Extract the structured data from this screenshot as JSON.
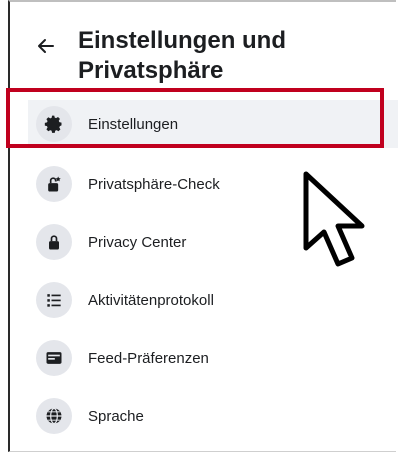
{
  "header": {
    "back_icon": "arrow-left-icon",
    "title": "Einstellungen und Privatsphäre"
  },
  "menu": {
    "items": [
      {
        "icon": "gear-icon",
        "label": "Einstellungen"
      },
      {
        "icon": "lock-check-icon",
        "label": "Privatsphäre-Check"
      },
      {
        "icon": "lock-icon",
        "label": "Privacy Center"
      },
      {
        "icon": "list-icon",
        "label": "Aktivitätenprotokoll"
      },
      {
        "icon": "feed-icon",
        "label": "Feed-Präferenzen"
      },
      {
        "icon": "globe-icon",
        "label": "Sprache"
      }
    ]
  },
  "colors": {
    "highlight": "#c0001e",
    "icon_bg": "#e4e6eb",
    "text": "#1c1e21"
  }
}
